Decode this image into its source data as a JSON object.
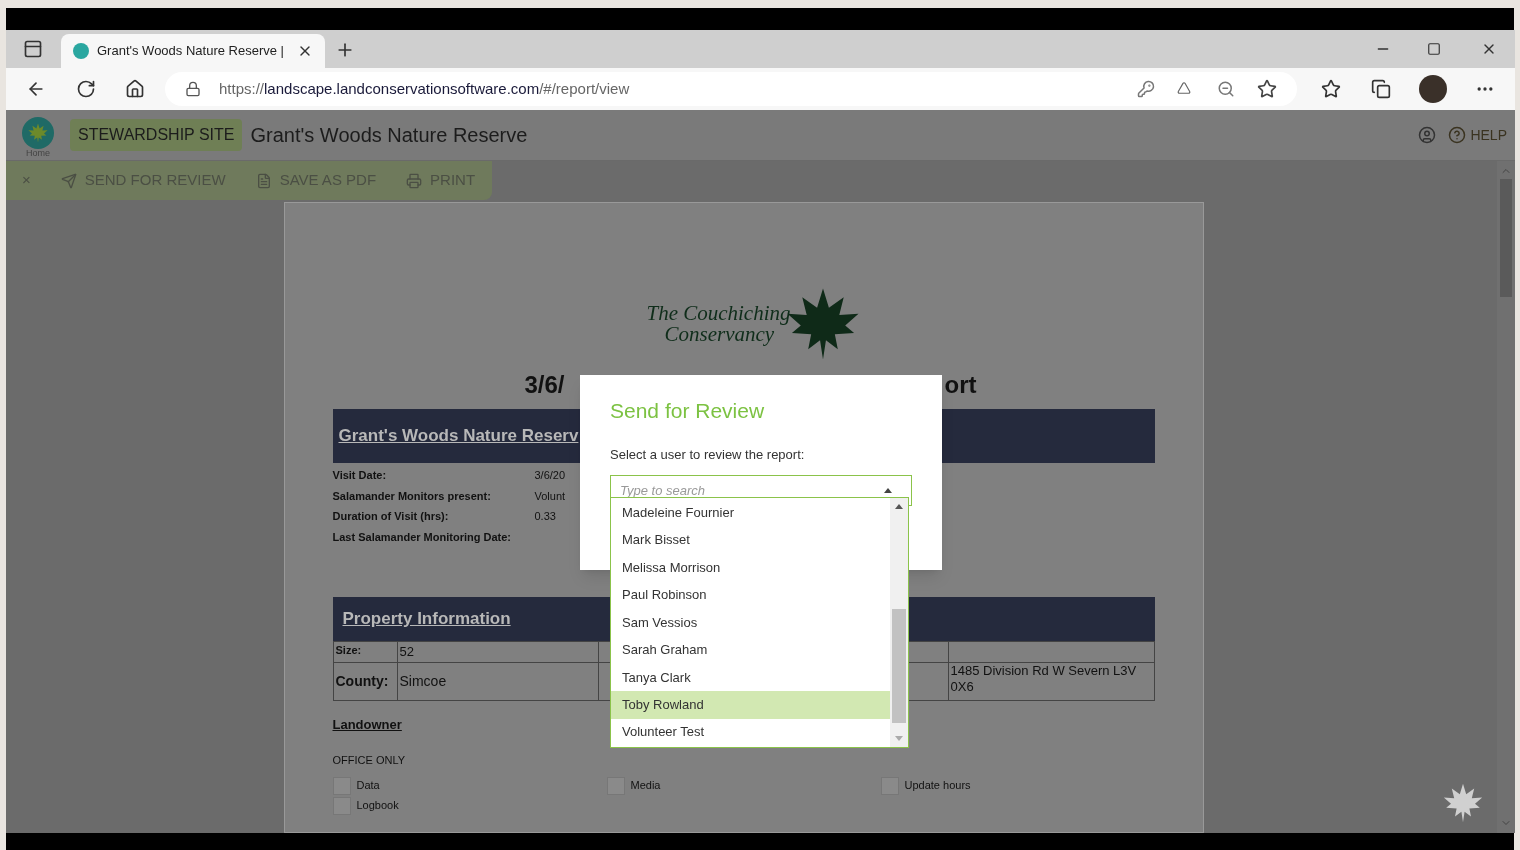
{
  "browser": {
    "tab_title": "Grant's Woods Nature Reserve |",
    "url_host": "landscape.landconservationsoftware.com",
    "url_scheme": "https://",
    "url_path": "/#/report/view"
  },
  "app_header": {
    "home_label": "Home",
    "site_badge": "STEWARDSHIP SITE",
    "site_name": "Grant's Woods Nature Reserve",
    "help": "HELP"
  },
  "toolbar": {
    "close": "×",
    "actions": [
      {
        "kind": "send",
        "label": "SEND FOR REVIEW"
      },
      {
        "kind": "pdf",
        "label": "SAVE AS PDF"
      },
      {
        "kind": "print",
        "label": "PRINT"
      }
    ]
  },
  "report": {
    "org_logo_lines": [
      "The Couchiching",
      "Conservancy"
    ],
    "title_left": "3/6/",
    "title_right": "ort",
    "site_band": "Grant's Woods Nature Reserv",
    "visit_fields": [
      {
        "label": "Visit Date:",
        "value": "3/6/20"
      },
      {
        "label": "Salamander Monitors present:",
        "value": "Volunt"
      },
      {
        "label": "Duration of Visit (hrs):",
        "value": "0.33"
      },
      {
        "label": "Last Salamander Monitoring Date:"
      }
    ],
    "property": {
      "heading": "Property Information",
      "rows": [
        {
          "label": "Size:",
          "value": "52"
        },
        {
          "label": "County:",
          "value": "Simcoe",
          "column_4": "1485 Division Rd W Severn L3V 0X6"
        }
      ]
    },
    "landowner": "Landowner",
    "office_only": "OFFICE ONLY",
    "checkboxes": [
      {
        "label": "Data",
        "checked": false
      },
      {
        "label": "Media",
        "checked": false
      },
      {
        "label": "Update hours",
        "checked": false
      },
      {
        "label": "Logbook",
        "checked": false
      }
    ]
  },
  "dialog": {
    "title": "Send for Review",
    "prompt": "Select a user to review the report:",
    "search": {
      "placeholder": "Type to search",
      "expanded": true
    },
    "options": [
      {
        "label": "Madeleine Fournier",
        "selected": false
      },
      {
        "label": "Mark Bisset",
        "selected": false
      },
      {
        "label": "Melissa Morrison",
        "selected": false
      },
      {
        "label": "Paul Robinson",
        "selected": false
      },
      {
        "label": "Sam Vessios",
        "selected": false
      },
      {
        "label": "Sarah Graham",
        "selected": false
      },
      {
        "label": "Tanya Clark",
        "selected": false
      },
      {
        "label": "Toby Rowland",
        "selected": true
      },
      {
        "label": "Volunteer Test",
        "selected": false
      }
    ]
  }
}
